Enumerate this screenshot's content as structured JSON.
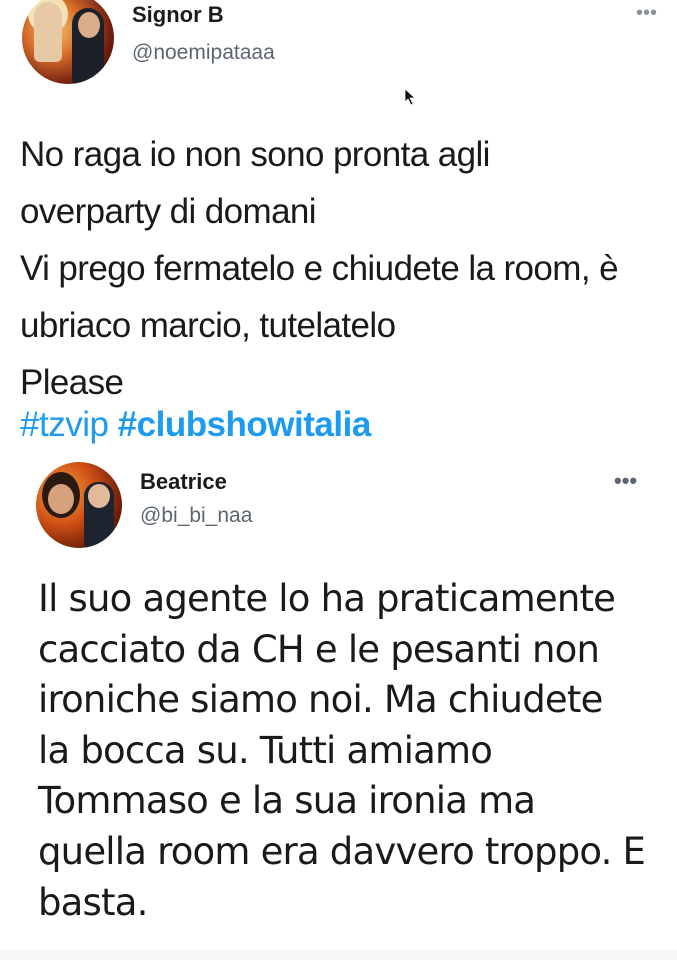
{
  "tweets": [
    {
      "display_name": "Signor B",
      "handle": "@noemipataaa",
      "more_label": "•••",
      "text_lines": [
        "No raga io non sono pronta agli",
        "overparty di domani",
        "Vi prego fermatelo e chiudete la room, è",
        "ubriaco marcio, tutelatelo",
        "Please"
      ],
      "hashtags": [
        "#tzvip",
        "#clubshowitalia"
      ]
    },
    {
      "display_name": "Beatrice",
      "handle": "@bi_bi_naa",
      "more_label": "•••",
      "text_lines": [
        "Il suo agente lo ha praticamente",
        "cacciato da CH e le pesanti non",
        "ironiche siamo noi. Ma chiudete",
        "la bocca su. Tutti amiamo",
        "Tommaso e la sua ironia ma",
        "quella room era davvero troppo. E",
        "basta."
      ]
    }
  ],
  "colors": {
    "hashtag": "#1d9bf0",
    "text": "#1a1a1a",
    "secondary": "#5c6670"
  }
}
